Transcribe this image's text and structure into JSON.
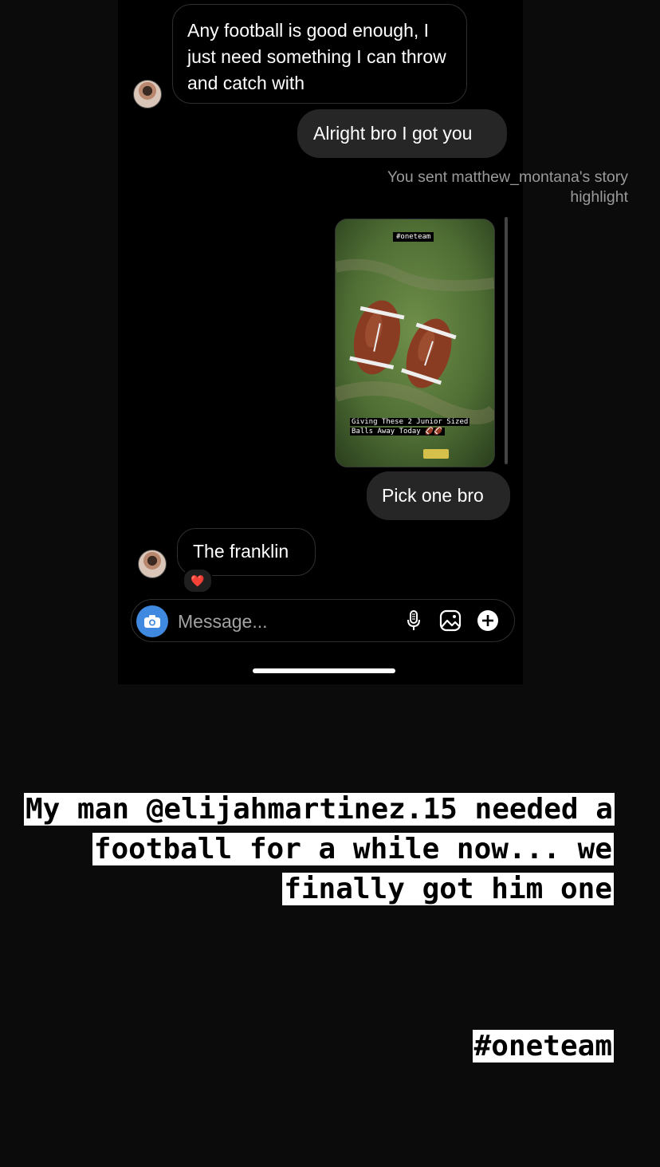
{
  "chat": {
    "messages": [
      {
        "text": "Any football is good enough, I just need something I can throw and catch with"
      },
      {
        "text": "Alright bro I got you"
      },
      {
        "text": "Pick one bro"
      },
      {
        "text": "The franklin"
      }
    ],
    "system_note": "You sent matthew_montana's story highlight",
    "story_preview": {
      "tag": "#oneteam",
      "caption": "Giving These 2 Junior Sized Balls Away Today 🏈🏈"
    },
    "reaction": "❤️",
    "composer": {
      "placeholder": "Message...",
      "icons": [
        "camera-icon",
        "microphone-icon",
        "gallery-icon",
        "plus-icon"
      ]
    }
  },
  "overlay": {
    "story_text": "My man @elijahmartinez.15 needed a football for a while now... we finally got him one",
    "hashtag": "#oneteam"
  },
  "colors": {
    "background": "#0b0b0b",
    "sent_bubble": "#262626",
    "camera_button": "#3f8ae0",
    "overlay_text_bg": "#ffffff"
  }
}
